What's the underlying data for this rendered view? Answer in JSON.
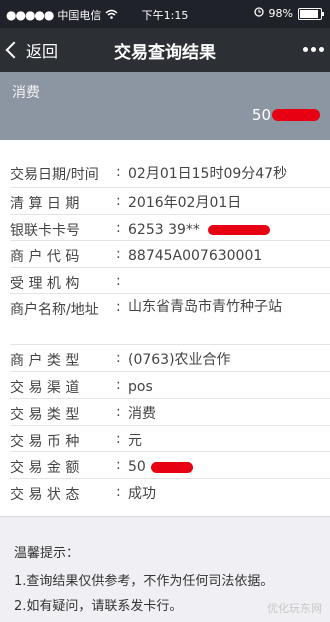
{
  "status_bar": {
    "carrier": "中国电信",
    "time": "下午1:15",
    "battery": "98%"
  },
  "nav": {
    "back_label": "返回",
    "title": "交易查询结果"
  },
  "summary": {
    "label": "消费",
    "amount_visible": "50"
  },
  "details": [
    {
      "key": "交易日期/时间",
      "value": "02月01日15时09分47秒"
    },
    {
      "key": "清 算 日 期",
      "value": "2016年02月01日"
    },
    {
      "key": "银联卡卡号",
      "value": "6253 39**"
    },
    {
      "key": "商 户 代 码",
      "value": "88745A007630001"
    },
    {
      "key": "受 理 机 构",
      "value": ""
    },
    {
      "key": "商户名称/地址",
      "value": "山东省青岛市青竹种子站"
    },
    {
      "key": "商 户 类 型",
      "value": "(0763)农业合作"
    },
    {
      "key": "交 易 渠 道",
      "value": "pos"
    },
    {
      "key": "交 易 类 型",
      "value": "消费"
    },
    {
      "key": "交 易 币 种",
      "value": "元"
    },
    {
      "key": "交 易 金 额",
      "value": "50"
    },
    {
      "key": "交 易 状 态",
      "value": "成功"
    }
  ],
  "notice": {
    "title": "温馨提示：",
    "line1": "1.查询结果仅供参考，不作为任何司法依据。",
    "line2": "2.如有疑问，请联系发卡行。"
  },
  "watermark": "优化玩东网",
  "colors": {
    "status_bar": "#1f2329",
    "nav_bar": "#2c2f34",
    "summary_panel": "#8c96a3",
    "redaction": "#e60012"
  }
}
